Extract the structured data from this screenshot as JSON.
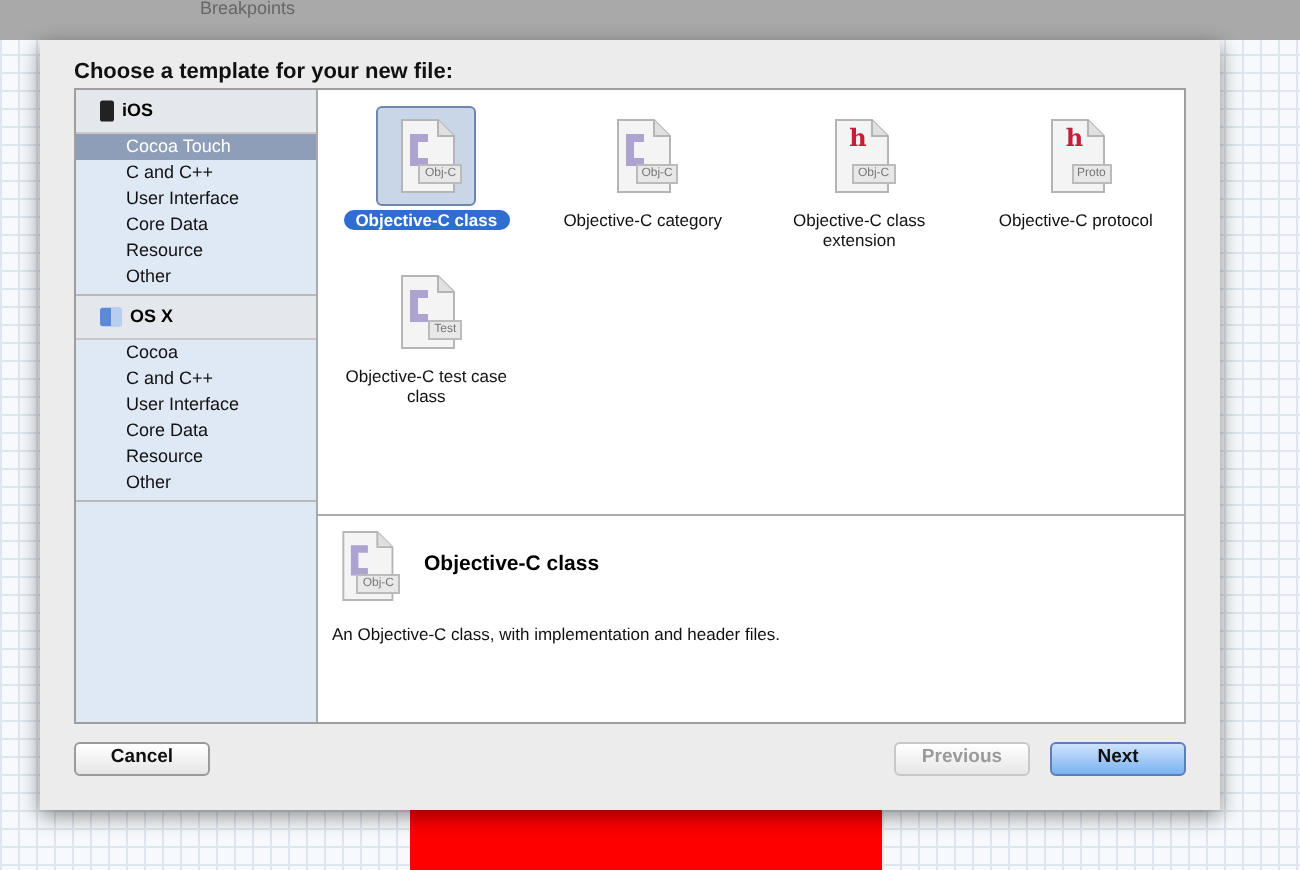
{
  "top_bar": {
    "label": "Breakpoints"
  },
  "dialog": {
    "title": "Choose a template for your new file:",
    "sidebar": [
      {
        "platform": "iOS",
        "kind": "phone",
        "items": [
          {
            "label": "Cocoa Touch",
            "selected": true
          },
          {
            "label": "C and C++",
            "selected": false
          },
          {
            "label": "User Interface",
            "selected": false
          },
          {
            "label": "Core Data",
            "selected": false
          },
          {
            "label": "Resource",
            "selected": false
          },
          {
            "label": "Other",
            "selected": false
          }
        ]
      },
      {
        "platform": "OS X",
        "kind": "mac",
        "items": [
          {
            "label": "Cocoa",
            "selected": false
          },
          {
            "label": "C and C++",
            "selected": false
          },
          {
            "label": "User Interface",
            "selected": false
          },
          {
            "label": "Core Data",
            "selected": false
          },
          {
            "label": "Resource",
            "selected": false
          },
          {
            "label": "Other",
            "selected": false
          }
        ]
      }
    ],
    "templates": [
      {
        "label": "Objective-C class",
        "kind": "source",
        "tag": "Obj-C",
        "selected": true
      },
      {
        "label": "Objective-C category",
        "kind": "source",
        "tag": "Obj-C",
        "selected": false
      },
      {
        "label": "Objective-C class extension",
        "kind": "header",
        "glyph": "h",
        "tag": "Obj-C",
        "selected": false
      },
      {
        "label": "Objective-C protocol",
        "kind": "header",
        "glyph": "h",
        "tag": "Proto",
        "selected": false
      },
      {
        "label": "Objective-C test case class",
        "kind": "source",
        "tag": "Test",
        "selected": false
      }
    ],
    "description": {
      "title": "Objective-C class",
      "kind": "source",
      "tag": "Obj-C",
      "text": "An Objective-C class, with implementation and header files."
    },
    "buttons": [
      {
        "label": "Cancel",
        "kind": "plain",
        "disabled": false
      },
      {
        "label": "Previous",
        "kind": "plain",
        "disabled": true
      },
      {
        "label": "Next",
        "kind": "default",
        "disabled": false
      }
    ]
  }
}
